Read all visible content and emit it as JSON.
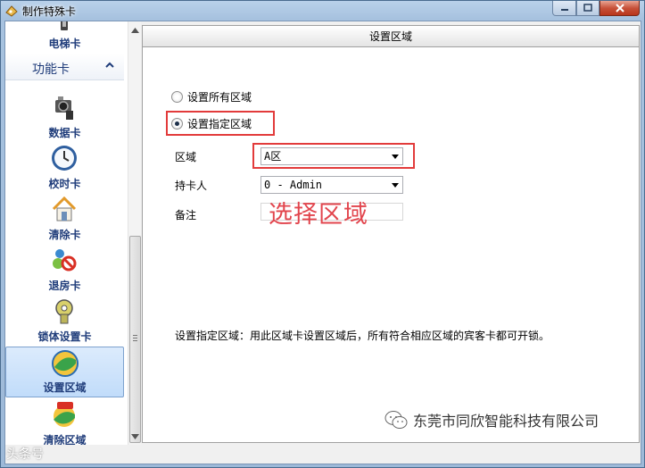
{
  "window": {
    "title": "制作特殊卡",
    "controls": [
      "minimize",
      "maximize",
      "close"
    ]
  },
  "sidebar": {
    "top_item": {
      "label": "电梯卡",
      "icon": "elevator-card-icon"
    },
    "group": {
      "label": "功能卡",
      "expanded": true
    },
    "items": [
      {
        "label": "数据卡",
        "icon": "camera-data-icon"
      },
      {
        "label": "校时卡",
        "icon": "clock-icon"
      },
      {
        "label": "清除卡",
        "icon": "house-clear-icon"
      },
      {
        "label": "退房卡",
        "icon": "checkout-icon"
      },
      {
        "label": "锁体设置卡",
        "icon": "lock-settings-icon"
      },
      {
        "label": "设置区域",
        "icon": "set-area-icon",
        "selected": true
      },
      {
        "label": "清除区域",
        "icon": "clear-area-icon"
      }
    ]
  },
  "panel": {
    "title": "设置区域",
    "options": [
      {
        "label": "设置所有区域",
        "checked": false
      },
      {
        "label": "设置指定区域",
        "checked": true
      }
    ],
    "fields": {
      "area": {
        "label": "区域",
        "value": "A区"
      },
      "card_holder": {
        "label": "持卡人",
        "value": "0 - Admin"
      },
      "note": {
        "label": "备注",
        "value": ""
      }
    },
    "annotation": "选择区域",
    "info": "设置指定区域：用此区域卡设置区域后，所有符合相应区域的宾客卡都可开锁。"
  },
  "watermarks": {
    "company": "东莞市同欣智能科技有限公司",
    "site": "头条号"
  },
  "colors": {
    "highlight": "#e23b3b",
    "annotation": "#e2454d",
    "sidebar_label": "#1f3c7a"
  }
}
